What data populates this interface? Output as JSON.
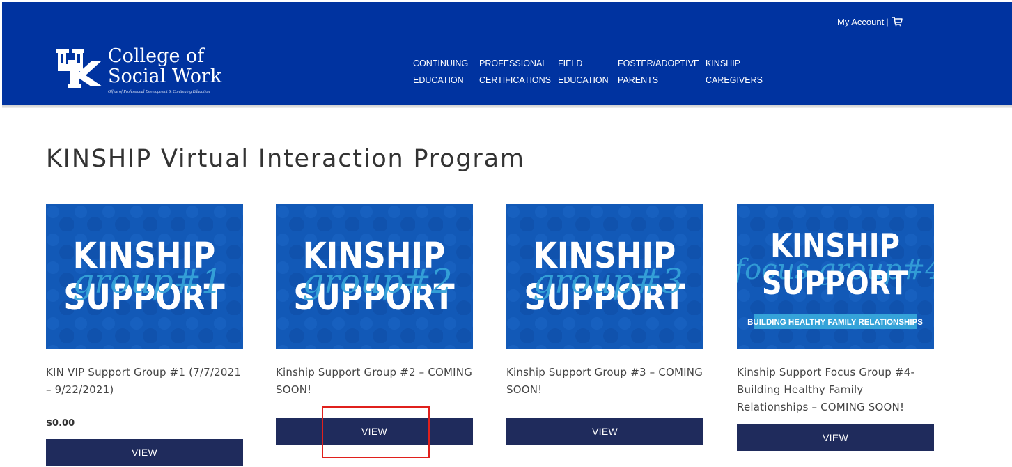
{
  "header": {
    "logo": {
      "mark": "UK",
      "title_line1": "College of",
      "title_line2": "Social Work",
      "subtitle": "Office of Professional Development & Continuing Education"
    },
    "account": {
      "label": "My Account",
      "separator": "|",
      "cart_icon": "cart-icon"
    },
    "nav": [
      {
        "line1": "CONTINUING",
        "line2": "EDUCATION"
      },
      {
        "line1": "PROFESSIONAL",
        "line2": "CERTIFICATIONS"
      },
      {
        "line1": "FIELD",
        "line2": "EDUCATION"
      },
      {
        "line1": "FOSTER/ADOPTIVE",
        "line2": "PARENTS"
      },
      {
        "line1": "KINSHIP",
        "line2": "CAREGIVERS"
      }
    ]
  },
  "main": {
    "title": "KINSHIP Virtual Interaction Program",
    "products": [
      {
        "image": {
          "line1": "KINSHIP",
          "line2": "SUPPORT",
          "script": "group",
          "number": "#1",
          "banner": ""
        },
        "name": "KIN VIP Support Group #1 (7/7/2021 – 9/22/2021)",
        "price": "$0.00",
        "button": "VIEW"
      },
      {
        "image": {
          "line1": "KINSHIP",
          "line2": "SUPPORT",
          "script": "group",
          "number": "#2",
          "banner": ""
        },
        "name": "Kinship Support Group #2 – COMING SOON!",
        "price": "",
        "button": "VIEW"
      },
      {
        "image": {
          "line1": "KINSHIP",
          "line2": "SUPPORT",
          "script": "group",
          "number": "#3",
          "banner": ""
        },
        "name": "Kinship Support Group #3 – COMING SOON!",
        "price": "",
        "button": "VIEW"
      },
      {
        "image": {
          "line1": "KINSHIP",
          "line2": "SUPPORT",
          "script": "focus group",
          "number": "#4",
          "banner": "BUILDING HEALTHY FAMILY RELATIONSHIPS"
        },
        "name": "Kinship Support Focus Group #4-Building Healthy Family Relationships – COMING SOON!",
        "price": "",
        "button": "VIEW"
      }
    ]
  },
  "colors": {
    "header_bg": "#0033a0",
    "button_bg": "#1f2b5c",
    "image_bg": "#1259b7",
    "script_color": "#35a3d9",
    "highlight": "#e0201c"
  }
}
